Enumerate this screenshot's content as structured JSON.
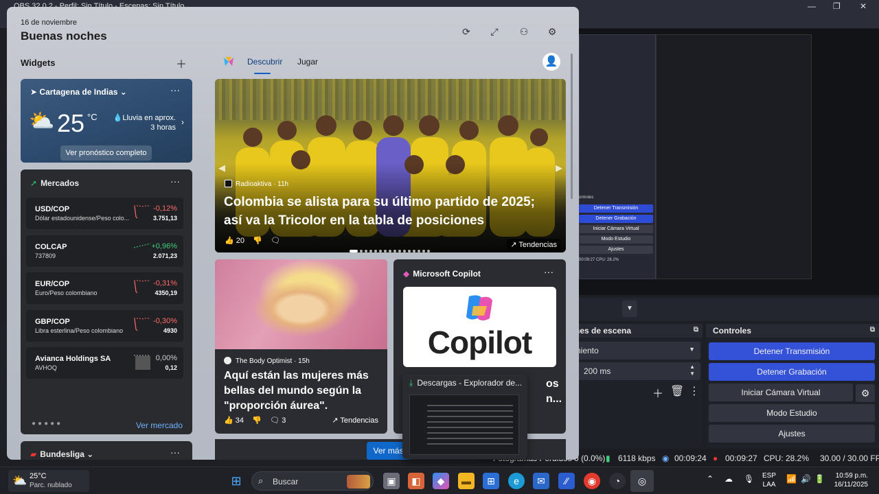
{
  "obs": {
    "title": "OBS 32.0.2 - Perfil: Sin Título - Escenas: Sin Título",
    "window_controls": [
      "—",
      "❐",
      "✕"
    ],
    "mini_controls_title": "ontroles",
    "mini_buttons": [
      "Detener Transmisión",
      "Detener Grabación",
      "Iniciar Cámara Virtual",
      "Modo Estudio",
      "Ajustes"
    ],
    "mini_stats": {
      "time": "00:09:27",
      "cpu": "CPU: 28.2%",
      "fps": "30.00 / 30.00 FPS",
      "lang": "ESP LAA",
      "clock": "10:59 p.m. 16/11/2025"
    },
    "transitions_title": "nes de escena",
    "transition_value": "imiento",
    "duration_value": "200 ms",
    "controls_title": "Controles",
    "controls_buttons": [
      "Detener Transmisión",
      "Detener Grabación",
      "Iniciar Cámara Virtual",
      "Modo Estudio",
      "Ajustes"
    ],
    "status": {
      "dropped": "Fotogramas Perdidos 0 (0.0%)",
      "bitrate": "6118 kbps",
      "stream_time": "00:09:24",
      "rec_time": "00:09:27",
      "cpu": "CPU: 28.2%",
      "fps": "30.00 / 30.00 FPS"
    }
  },
  "widgets": {
    "date": "16 de noviembre",
    "greeting": "Buenas noches",
    "section_label": "Widgets",
    "weather": {
      "location": "Cartagena de Indias",
      "temp": "25",
      "unit": "°C",
      "rain_line1": "Lluvia en aprox.",
      "rain_line2": "3 horas",
      "forecast_link": "Ver pronóstico completo"
    },
    "markets": {
      "title": "Mercados",
      "rows": [
        {
          "symbol": "USD/COP",
          "name": "Dólar estadounidense/Peso colo...",
          "change": "-0,12%",
          "value": "3.751,13",
          "trend": "neg"
        },
        {
          "symbol": "COLCAP",
          "name": "737809",
          "change": "+0,96%",
          "value": "2.071,23",
          "trend": "pos"
        },
        {
          "symbol": "EUR/COP",
          "name": "Euro/Peso colombiano",
          "change": "-0,31%",
          "value": "4350,19",
          "trend": "neg"
        },
        {
          "symbol": "GBP/COP",
          "name": "Libra esterlina/Peso colombiano",
          "change": "-0,30%",
          "value": "4930",
          "trend": "neg"
        },
        {
          "symbol": "Avianca Holdings SA",
          "name": "AVHOQ",
          "change": "0,00%",
          "value": "0,12",
          "trend": "flat"
        }
      ],
      "link": "Ver mercado"
    },
    "bundesliga": {
      "title": "Bundesliga"
    }
  },
  "feed": {
    "tabs": [
      "Descubrir",
      "Jugar"
    ],
    "hero": {
      "source": "Radioaktiva",
      "age": "11h",
      "title": "Colombia se alista para su último partido de 2025; así va la Tricolor en la tabla de posiciones",
      "likes": "20",
      "trend": "Tendencias"
    },
    "story2": {
      "source": "The Body Optimist",
      "age": "15h",
      "title": "Aquí están las mujeres más bellas del mundo según la \"proporción áurea\".",
      "likes": "34",
      "comments": "3",
      "trend": "Tendencias"
    },
    "copilot": {
      "title": "Microsoft Copilot",
      "logo_text": "Copilot",
      "frag1": "os",
      "frag2": "n..."
    },
    "ver_mas": "Ver más"
  },
  "thumbnail": {
    "title": "Descargas - Explorador de..."
  },
  "taskbar": {
    "weather_temp": "25°C",
    "weather_desc": "Parc. nublado",
    "search_label": "Buscar",
    "lang1": "ESP",
    "lang2": "LAA",
    "time": "10:59 p.m.",
    "date": "16/11/2025"
  },
  "colors": {
    "obs_blue": "#3452d8",
    "negative": "#ff6b6b",
    "positive": "#3fd07f",
    "accent": "#0f68c9"
  }
}
